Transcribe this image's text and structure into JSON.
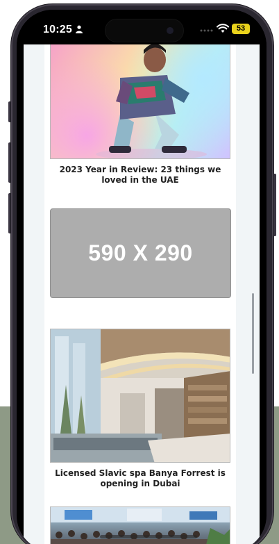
{
  "status_bar": {
    "time": "10:25",
    "battery_level": "53",
    "icons": [
      "person-icon",
      "wifi-icon",
      "cellular-dots-icon",
      "battery-icon"
    ]
  },
  "articles": [
    {
      "caption": "2023 Year in Review: 23 things we loved in the UAE",
      "image": "person-crouching-colorful-photo"
    },
    {
      "caption": "Licensed Slavic spa Banya Forrest is opening in Dubai",
      "image": "spa-interior-photo"
    },
    {
      "caption": "",
      "image": "crowd-event-photo"
    }
  ],
  "ad_placeholder": {
    "label": "590 X 290",
    "background_color": "#adadad"
  },
  "colors": {
    "page_background": "#f1f5f7",
    "battery": "#e9d21c",
    "backdrop_olive": "#8e9a86"
  }
}
